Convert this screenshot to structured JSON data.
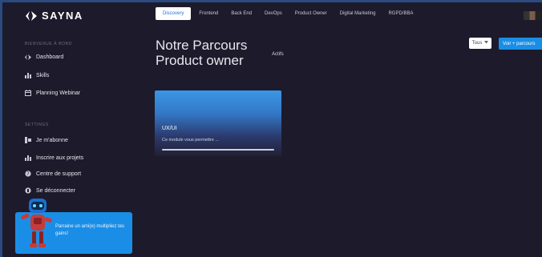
{
  "app": {
    "name": "SAYNA"
  },
  "nav_tabs": [
    {
      "label": "Discovery",
      "active": true
    },
    {
      "label": "Frontend",
      "active": false
    },
    {
      "label": "Back End",
      "active": false
    },
    {
      "label": "DevOps",
      "active": false
    },
    {
      "label": "Product Owner",
      "active": false
    },
    {
      "label": "Digital Marketing",
      "active": false
    },
    {
      "label": "RGPD/BBA",
      "active": false
    }
  ],
  "sidebar": {
    "section1_title": "BIENVENUE À BORD",
    "items": [
      {
        "label": "Dashboard",
        "icon": "sayna-logo-icon"
      },
      {
        "label": "Skills",
        "icon": "bar-chart-icon"
      },
      {
        "label": "Planning Webinar",
        "icon": "calendar-icon"
      }
    ],
    "section2_title": "SETTINGS",
    "items2": [
      {
        "label": "Je m'abonne",
        "icon": "subscribe-icon"
      },
      {
        "label": "Inscrire aux projets",
        "icon": "bar-chart-icon"
      },
      {
        "label": "Centre de support",
        "icon": "help-icon"
      },
      {
        "label": "Se déconnecter",
        "icon": "logout-icon"
      }
    ]
  },
  "promo": {
    "text": "Parraine un ami(e) multipliez tes gains!"
  },
  "main": {
    "title_line1": "Notre Parcours",
    "title_line2": "Product owner",
    "status": "Actifs",
    "filter_label": "Tous",
    "cta_label": "Voir + parcours"
  },
  "card": {
    "title": "UX/UI",
    "description": "Ce module vous permettre ...",
    "progress": 1.0
  },
  "colors": {
    "accent": "#1a8ee6",
    "background": "#1d1b2b",
    "frame": "#2a4a80"
  }
}
